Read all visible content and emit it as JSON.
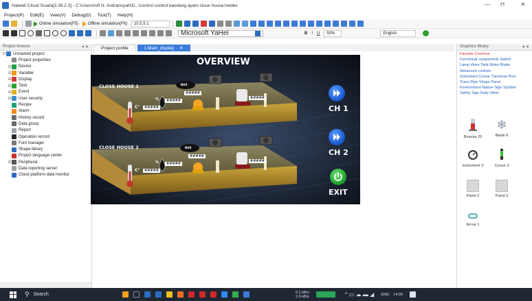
{
  "window": {
    "title": "Haiwell Cloud Scada[3.36.2.3] - C:\\Users\\Isfi N. Ardnansyah\\D...\\control control kandang ayam close house.hwdev",
    "min": "—",
    "max": "⊓",
    "close": "✕"
  },
  "menu": [
    "Project(P)",
    "Edit(E)",
    "View(V)",
    "Debug(D)",
    "Tool(T)",
    "Help(H)"
  ],
  "toolbar": {
    "online_sim": "Online simulation(F5)",
    "offline_sim": "Offline simulation(F6)",
    "ip": "10.5.5.1",
    "font": "Microsoft YaHei",
    "zoom": "50%",
    "language": "English"
  },
  "left_panel": {
    "title": "Project browse",
    "controls": "▾ ✕",
    "items": [
      {
        "label": "Unnamed project",
        "color": "#3a76c8",
        "level": 0,
        "exp": "⊟"
      },
      {
        "label": "Project properties",
        "color": "#8a8a8a",
        "level": 1,
        "exp": ""
      },
      {
        "label": "Device",
        "color": "#22a046",
        "level": 1,
        "exp": "⊞"
      },
      {
        "label": "Variable",
        "color": "#f09a1b",
        "level": 1,
        "exp": "⊞"
      },
      {
        "label": "Display",
        "color": "#d23a3a",
        "level": 1,
        "exp": "⊞"
      },
      {
        "label": "Task",
        "color": "#2ca02c",
        "level": 1,
        "exp": "⊞"
      },
      {
        "label": "Event",
        "color": "#e0b020",
        "level": 1,
        "exp": "⊞"
      },
      {
        "label": "User security",
        "color": "#3a8ad0",
        "level": 1,
        "exp": "⊞"
      },
      {
        "label": "Recipe",
        "color": "#1e9e7a",
        "level": 1,
        "exp": ""
      },
      {
        "label": "Alarm",
        "color": "#f08c1a",
        "level": 1,
        "exp": ""
      },
      {
        "label": "History record",
        "color": "#6b6b6b",
        "level": 1,
        "exp": ""
      },
      {
        "label": "Data group",
        "color": "#6b6b6b",
        "level": 1,
        "exp": ""
      },
      {
        "label": "Report",
        "color": "#9aa0a8",
        "level": 1,
        "exp": ""
      },
      {
        "label": "Operation record",
        "color": "#2b2b2b",
        "level": 1,
        "exp": ""
      },
      {
        "label": "Font manager",
        "color": "#7a7a7a",
        "level": 1,
        "exp": ""
      },
      {
        "label": "Shape library",
        "color": "#2d6cc0",
        "level": 1,
        "exp": ""
      },
      {
        "label": "Project language center",
        "color": "#c8342c",
        "level": 1,
        "exp": ""
      },
      {
        "label": "Peripheral",
        "color": "#555555",
        "level": 1,
        "exp": "⊞"
      },
      {
        "label": "Data reporting server",
        "color": "#9aa0a8",
        "level": 1,
        "exp": ""
      },
      {
        "label": "Cloud platform data monitor",
        "color": "#2d6cc0",
        "level": 1,
        "exp": ""
      }
    ]
  },
  "tabs": [
    {
      "label": "Project profile",
      "active": false
    },
    {
      "label": "1.Main_display",
      "active": true,
      "close": "✕"
    }
  ],
  "hmi": {
    "title": "OVERVIEW",
    "house1": "CLOSE HOUSE 1",
    "house2": "CLOSE HOUSE 2",
    "ch1": "CH 1",
    "ch2": "CH 2",
    "exit": "EXIT",
    "temp_unit": "C°",
    "humidity_unit": "%",
    "nh3": "NH3",
    "value_placeholder": "#####",
    "colors": {
      "bg": "#0c0f15",
      "accent_blue": "#1d5fd6",
      "exit_green": "#23a52e"
    }
  },
  "right_panel": {
    "title": "Graphics library",
    "categories": [
      {
        "text": "Favorite Common",
        "active": true
      },
      {
        "text": "Functional components  Switch",
        "active": false
      },
      {
        "text": "Lamp  Valve  Tank  Motor Blade",
        "active": false
      },
      {
        "text": "Advanced controls",
        "active": false
      },
      {
        "text": "Instrument Cursor  Traceless Pool",
        "active": false
      },
      {
        "text": "Trace Pipe  Shape Panel",
        "active": false
      },
      {
        "text": "Environment Nature  Sign Symbol",
        "active": false
      },
      {
        "text": "Safety Sign  Daily Other",
        "active": false
      }
    ],
    "items": [
      "Reactor 25",
      "Blade 6",
      "Instrument 3",
      "Cursor 3",
      "Panel 2",
      "Panel 3",
      "Arrow 1"
    ]
  },
  "taskbar": {
    "search": "Search",
    "net_up": "0.1 kB/s",
    "net_down": "2.5 kB/s",
    "lang": "ENG",
    "time": "14:00"
  }
}
